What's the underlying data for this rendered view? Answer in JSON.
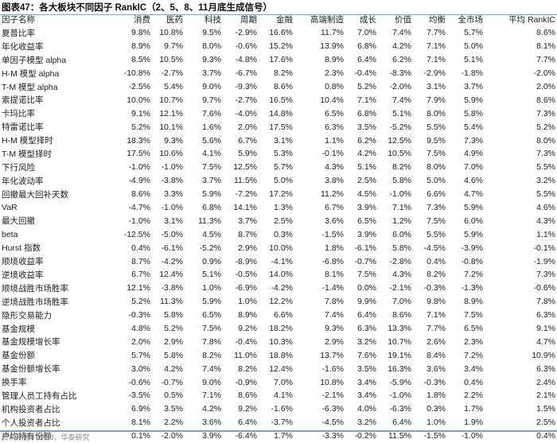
{
  "title": "图表47：各大板块不同因子 RankIC（2、5、8、11月底生成信号）",
  "columns": [
    "因子名称",
    "消费",
    "医药",
    "科技",
    "周期",
    "金融",
    "高端制造",
    "成长",
    "价值",
    "均衡",
    "全市场",
    "平均 RankIC"
  ],
  "rows": [
    [
      "夏普比率",
      "9.8%",
      "10.8%",
      "9.5%",
      "-2.9%",
      "16.6%",
      "11.7%",
      "7.0%",
      "7.4%",
      "7.7%",
      "5.7%",
      "8.6%"
    ],
    [
      "年化收益率",
      "8.9%",
      "9.7%",
      "8.0%",
      "-0.6%",
      "15.2%",
      "13.9%",
      "6.8%",
      "4.2%",
      "7.1%",
      "5.0%",
      "8.1%"
    ],
    [
      "单因子模型 alpha",
      "8.5%",
      "10.5%",
      "9.3%",
      "-4.8%",
      "17.6%",
      "8.9%",
      "6.4%",
      "6.2%",
      "7.1%",
      "5.1%",
      "7.7%"
    ],
    [
      "H-M 模型 alpha",
      "-10.8%",
      "-2.7%",
      "3.7%",
      "-6.7%",
      "8.2%",
      "2.3%",
      "-0.4%",
      "-8.3%",
      "-2.9%",
      "-1.8%",
      "-2.0%"
    ],
    [
      "T-M 模型 alpha",
      "-2.5%",
      "5.4%",
      "9.0%",
      "-9.3%",
      "8.6%",
      "0.8%",
      "5.2%",
      "-2.0%",
      "3.1%",
      "3.7%",
      "2.0%"
    ],
    [
      "索提诺比率",
      "10.0%",
      "10.7%",
      "9.7%",
      "-2.7%",
      "16.5%",
      "10.4%",
      "7.1%",
      "7.4%",
      "7.9%",
      "5.9%",
      "8.6%"
    ],
    [
      "卡玛比率",
      "9.1%",
      "12.1%",
      "7.6%",
      "-4.0%",
      "14.8%",
      "6.5%",
      "6.8%",
      "5.1%",
      "8.0%",
      "5.8%",
      "7.3%"
    ],
    [
      "特雷诺比率",
      "5.2%",
      "10.1%",
      "1.6%",
      "2.0%",
      "17.5%",
      "6.3%",
      "3.5%",
      "-5.2%",
      "5.5%",
      "5.4%",
      "5.2%"
    ],
    [
      "H-M 模型择时",
      "18.3%",
      "9.3%",
      "5.6%",
      "6.7%",
      "3.1%",
      "1.1%",
      "6.2%",
      "12.5%",
      "9.5%",
      "7.3%",
      "8.0%"
    ],
    [
      "T-M 模型择时",
      "17.5%",
      "10.6%",
      "4.1%",
      "5.9%",
      "5.3%",
      "-0.1%",
      "4.2%",
      "10.5%",
      "7.5%",
      "4.9%",
      "7.3%"
    ],
    [
      "下行风险",
      "-1.0%",
      "-1.0%",
      "7.5%",
      "12.5%",
      "5.7%",
      "4.3%",
      "5.1%",
      "8.2%",
      "8.0%",
      "7.0%",
      "5.5%"
    ],
    [
      "年化波动率",
      "-4.9%",
      "-3.8%",
      "3.7%",
      "11.5%",
      "5.0%",
      "3.8%",
      "2.5%",
      "5.8%",
      "5.0%",
      "4.6%",
      "3.2%"
    ],
    [
      "回撤最大回补天数",
      "8.6%",
      "3.3%",
      "5.9%",
      "-7.2%",
      "17.2%",
      "11.2%",
      "4.5%",
      "-1.0%",
      "6.6%",
      "4.7%",
      "5.5%"
    ],
    [
      "VaR",
      "-4.7%",
      "-1.0%",
      "6.8%",
      "14.1%",
      "1.3%",
      "6.7%",
      "3.9%",
      "7.1%",
      "7.3%",
      "5.9%",
      "4.6%"
    ],
    [
      "最大回撤",
      "-1.0%",
      "3.1%",
      "11.3%",
      "3.7%",
      "2.5%",
      "3.6%",
      "6.5%",
      "1.2%",
      "7.5%",
      "6.0%",
      "4.3%"
    ],
    [
      "beta",
      "-12.5%",
      "-5.0%",
      "4.5%",
      "8.7%",
      "0.3%",
      "-1.5%",
      "3.9%",
      "6.0%",
      "5.5%",
      "5.9%",
      "1.1%"
    ],
    [
      "Hurst 指数",
      "0.4%",
      "-6.1%",
      "-5.2%",
      "2.9%",
      "10.0%",
      "1.8%",
      "-6.1%",
      "5.8%",
      "-4.5%",
      "-3.9%",
      "-0.1%"
    ],
    [
      "顺境收益率",
      "8.7%",
      "-4.2%",
      "0.9%",
      "-8.9%",
      "-4.1%",
      "-6.8%",
      "-0.7%",
      "-2.8%",
      "0.4%",
      "-0.8%",
      "-1.9%"
    ],
    [
      "逆境收益率",
      "6.7%",
      "12.4%",
      "5.1%",
      "-0.5%",
      "14.0%",
      "8.1%",
      "7.5%",
      "4.3%",
      "8.2%",
      "7.2%",
      "7.3%"
    ],
    [
      "顺境战胜市场胜率",
      "12.1%",
      "-3.8%",
      "1.0%",
      "-6.9%",
      "-4.2%",
      "-1.4%",
      "0.0%",
      "-2.1%",
      "-0.3%",
      "-1.3%",
      "-0.6%"
    ],
    [
      "逆境战胜市场胜率",
      "5.2%",
      "11.3%",
      "5.9%",
      "1.0%",
      "12.2%",
      "7.8%",
      "9.9%",
      "7.0%",
      "9.8%",
      "8.9%",
      "7.8%"
    ],
    [
      "隐形交易能力",
      "-0.3%",
      "5.8%",
      "6.5%",
      "8.9%",
      "6.6%",
      "7.4%",
      "6.4%",
      "8.6%",
      "7.1%",
      "7.5%",
      "6.3%"
    ],
    [
      "基金规模",
      "4.8%",
      "5.2%",
      "7.5%",
      "9.2%",
      "18.2%",
      "9.3%",
      "6.3%",
      "13.3%",
      "7.7%",
      "6.5%",
      "9.1%"
    ],
    [
      "基金规模增长率",
      "2.0%",
      "2.9%",
      "7.8%",
      "-0.4%",
      "10.3%",
      "2.9%",
      "3.2%",
      "10.7%",
      "2.6%",
      "2.3%",
      "4.7%"
    ],
    [
      "基金份额",
      "5.7%",
      "5.8%",
      "8.2%",
      "11.0%",
      "18.8%",
      "13.7%",
      "7.6%",
      "19.1%",
      "8.4%",
      "7.2%",
      "10.9%"
    ],
    [
      "基金份额增长率",
      "3.0%",
      "4.2%",
      "7.4%",
      "8.2%",
      "12.4%",
      "-1.6%",
      "3.5%",
      "16.3%",
      "3.6%",
      "3.4%",
      "6.3%"
    ],
    [
      "换手率",
      "-0.6%",
      "-0.7%",
      "9.0%",
      "-0.9%",
      "7.0%",
      "10.8%",
      "3.4%",
      "-5.9%",
      "-0.3%",
      "0.4%",
      "2.4%"
    ],
    [
      "管理人员工持有占比",
      "-3.5%",
      "0.5%",
      "7.1%",
      "8.6%",
      "4.1%",
      "-2.1%",
      "3.4%",
      "-1.0%",
      "1.8%",
      "2.2%",
      "2.1%"
    ],
    [
      "机构投资者占比",
      "6.9%",
      "3.5%",
      "4.2%",
      "9.2%",
      "-1.6%",
      "-6.3%",
      "4.0%",
      "-6.3%",
      "0.3%",
      "1.7%",
      "1.5%"
    ],
    [
      "个人投资者占比",
      "8.1%",
      "2.2%",
      "3.6%",
      "6.4%",
      "-3.7%",
      "-4.5%",
      "3.2%",
      "6.4%",
      "1.0%",
      "1.9%",
      "2.5%"
    ],
    [
      "户均持有份额",
      "0.1%",
      "-2.0%",
      "3.9%",
      "-6.4%",
      "1.7%",
      "-3.3%",
      "-0.2%",
      "11.5%",
      "-1.5%",
      "-1.0%",
      "0.4%"
    ]
  ],
  "source": "资料来源：Wind，华泰研究",
  "colors": {
    "rule": "#7f9fc3",
    "text": "#222222",
    "source": "#888888"
  }
}
